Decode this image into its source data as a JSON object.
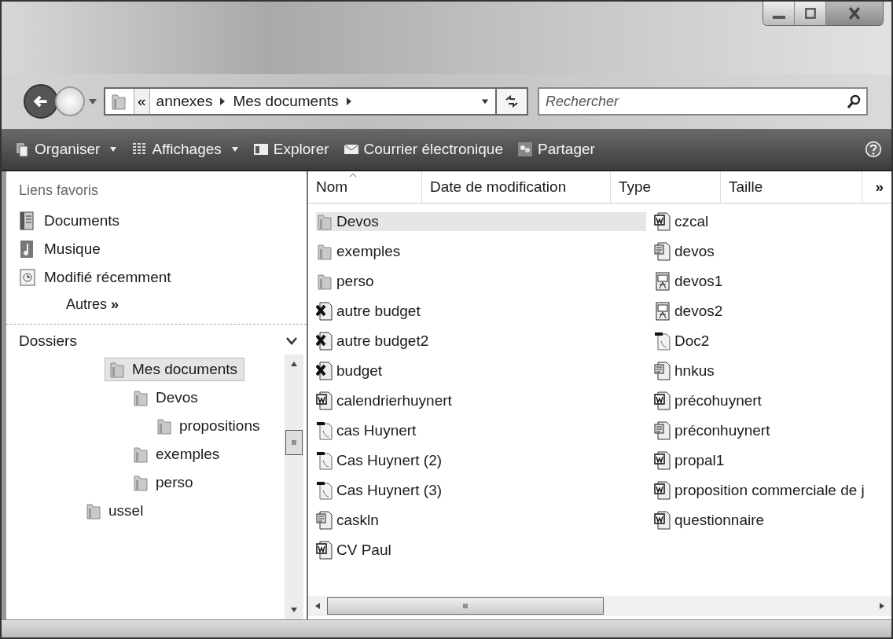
{
  "address_bar": {
    "overflow": "«",
    "crumbs": [
      "annexes",
      "Mes documents"
    ]
  },
  "search": {
    "placeholder": "Rechercher"
  },
  "toolbar": [
    {
      "label": "Organiser",
      "kind": "organize",
      "dropdown": true
    },
    {
      "label": "Affichages",
      "kind": "views",
      "dropdown": true
    },
    {
      "label": "Explorer",
      "kind": "explore",
      "dropdown": false
    },
    {
      "label": "Courrier électronique",
      "kind": "email",
      "dropdown": false
    },
    {
      "label": "Partager",
      "kind": "share",
      "dropdown": false
    }
  ],
  "favorites": {
    "title": "Liens favoris",
    "items": [
      {
        "label": "Documents",
        "kind": "documents"
      },
      {
        "label": "Musique",
        "kind": "music"
      },
      {
        "label": "Modifié récemment",
        "kind": "recent"
      }
    ],
    "more": "Autres",
    "more_glyph": "»"
  },
  "folders": {
    "title": "Dossiers",
    "tree": [
      {
        "children": [
          {
            "label": "Mes documents",
            "selected": true,
            "children": [
              {
                "label": "Devos",
                "selected": false,
                "children": [
                  {
                    "label": "propositions",
                    "selected": false
                  }
                ]
              },
              {
                "label": "exemples",
                "selected": false
              },
              {
                "label": "perso",
                "selected": false
              }
            ]
          }
        ]
      },
      {
        "label": "ussel",
        "selected": false
      }
    ]
  },
  "columns": [
    {
      "label": "Nom",
      "sorted": true
    },
    {
      "label": "Date de modification",
      "sorted": false
    },
    {
      "label": "Type",
      "sorted": false
    },
    {
      "label": "Taille",
      "sorted": false
    }
  ],
  "columns_more": "»",
  "files": [
    {
      "name": "Devos",
      "kind": "folder",
      "selected": true
    },
    {
      "name": "exemples",
      "kind": "folder",
      "selected": false
    },
    {
      "name": "perso",
      "kind": "folder",
      "selected": false
    },
    {
      "name": "autre budget",
      "kind": "excel",
      "selected": false
    },
    {
      "name": "autre budget2",
      "kind": "excel",
      "selected": false
    },
    {
      "name": "budget",
      "kind": "excel",
      "selected": false
    },
    {
      "name": "calendrierhuynert",
      "kind": "word",
      "selected": false
    },
    {
      "name": "cas Huynert",
      "kind": "pdf",
      "selected": false
    },
    {
      "name": "Cas Huynert (2)",
      "kind": "pdf",
      "selected": false
    },
    {
      "name": "Cas Huynert (3)",
      "kind": "pdf",
      "selected": false
    },
    {
      "name": "caskln",
      "kind": "publisher",
      "selected": false
    },
    {
      "name": "CV Paul",
      "kind": "word",
      "selected": false
    },
    {
      "name": "czcal",
      "kind": "word",
      "selected": false
    },
    {
      "name": "devos",
      "kind": "publisher",
      "selected": false
    },
    {
      "name": "devos1",
      "kind": "slides",
      "selected": false
    },
    {
      "name": "devos2",
      "kind": "slides",
      "selected": false
    },
    {
      "name": "Doc2",
      "kind": "pdf",
      "selected": false
    },
    {
      "name": "hnkus",
      "kind": "publisher",
      "selected": false
    },
    {
      "name": "précohuynert",
      "kind": "word",
      "selected": false
    },
    {
      "name": "préconhuynert",
      "kind": "publisher",
      "selected": false
    },
    {
      "name": "propal1",
      "kind": "word",
      "selected": false
    },
    {
      "name": "proposition commerciale de j",
      "kind": "word",
      "selected": false
    },
    {
      "name": "questionnaire",
      "kind": "word",
      "selected": false
    }
  ]
}
